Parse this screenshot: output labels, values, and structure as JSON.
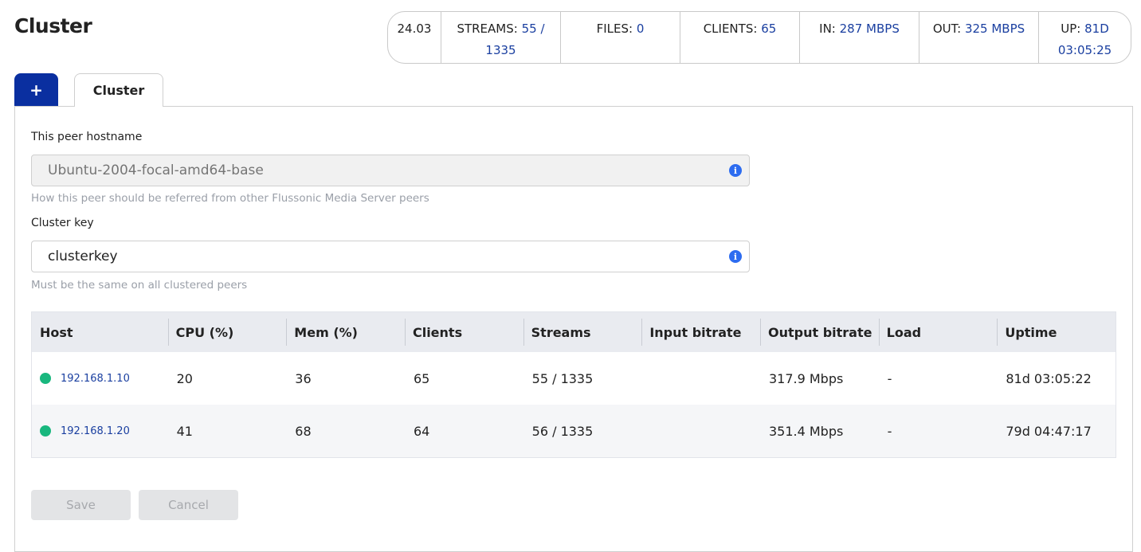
{
  "page": {
    "title": "Cluster"
  },
  "stats": {
    "version": "24.03",
    "streams_label": "STREAMS:",
    "streams_value": "55 / 1335",
    "files_label": "FILES:",
    "files_value": "0",
    "clients_label": "CLIENTS:",
    "clients_value": "65",
    "in_label": "IN:",
    "in_value": "287 MBPS",
    "out_label": "OUT:",
    "out_value": "325 MBPS",
    "up_label": "UP:",
    "up_value_days": "81D",
    "up_value_time": "03:05:25"
  },
  "tabs": {
    "add_label": "+",
    "cluster_label": "Cluster"
  },
  "form": {
    "hostname_label": "This peer hostname",
    "hostname_placeholder": "Ubuntu-2004-focal-amd64-base",
    "hostname_help": "How this peer should be referred from other Flussonic Media Server peers",
    "key_label": "Cluster key",
    "key_value": "clusterkey",
    "key_help": "Must be the same on all clustered peers"
  },
  "table": {
    "headers": [
      "Host",
      "CPU (%)",
      "Mem (%)",
      "Clients",
      "Streams",
      "Input bitrate",
      "Output bitrate",
      "Load",
      "Uptime"
    ],
    "rows": [
      {
        "host": "192.168.1.10",
        "cpu": "20",
        "mem": "36",
        "clients": "65",
        "streams": "55 / 1335",
        "input_bitrate": "",
        "output_bitrate": "317.9 Mbps",
        "load": "-",
        "uptime": "81d 03:05:22",
        "status_color": "#19b77e"
      },
      {
        "host": "192.168.1.20",
        "cpu": "41",
        "mem": "68",
        "clients": "64",
        "streams": "56 / 1335",
        "input_bitrate": "",
        "output_bitrate": "351.4 Mbps",
        "load": "-",
        "uptime": "79d 04:47:17",
        "status_color": "#19b77e"
      }
    ]
  },
  "buttons": {
    "save_label": "Save",
    "cancel_label": "Cancel"
  },
  "colors": {
    "accent": "#0a2fa0",
    "link": "#1a3fa0",
    "status_ok": "#19b77e",
    "info": "#2d6cf0"
  }
}
